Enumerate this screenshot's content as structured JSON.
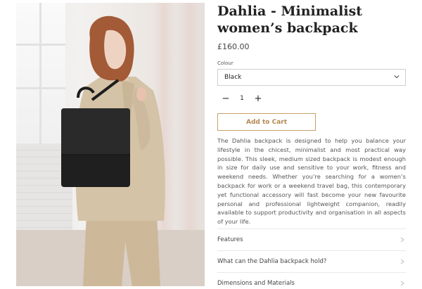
{
  "product": {
    "title": "Dahlia - Minimalist women’s backpack",
    "price": "£160.00"
  },
  "colour": {
    "label": "Colour",
    "selected": "Black"
  },
  "quantity": {
    "minus": "−",
    "value": "1",
    "plus": "+"
  },
  "cart": {
    "button_label": "Add to Cart",
    "accent_color": "#b48a52"
  },
  "description": "The Dahlia backpack is designed to help you balance your lifestyle in the chicest, minimalist and most practical way possible. This sleek, medium sized backpack is modest enough in size for daily use and sensitive to your work, fitness and weekend needs. Whether you’re searching for a women’s backpack for work or a weekend travel bag, this contemporary yet functional accessory will fast become your new favourite personal and professional lightweight companion, readily available to support productivity and organisation in all aspects of your life.",
  "accordion": [
    {
      "label": "Features",
      "icon": "chevron-right-icon"
    },
    {
      "label": "What can the Dahlia backpack hold?",
      "icon": "chevron-right-icon"
    },
    {
      "label": "Dimensions and Materials",
      "icon": "chevron-right-icon"
    }
  ]
}
